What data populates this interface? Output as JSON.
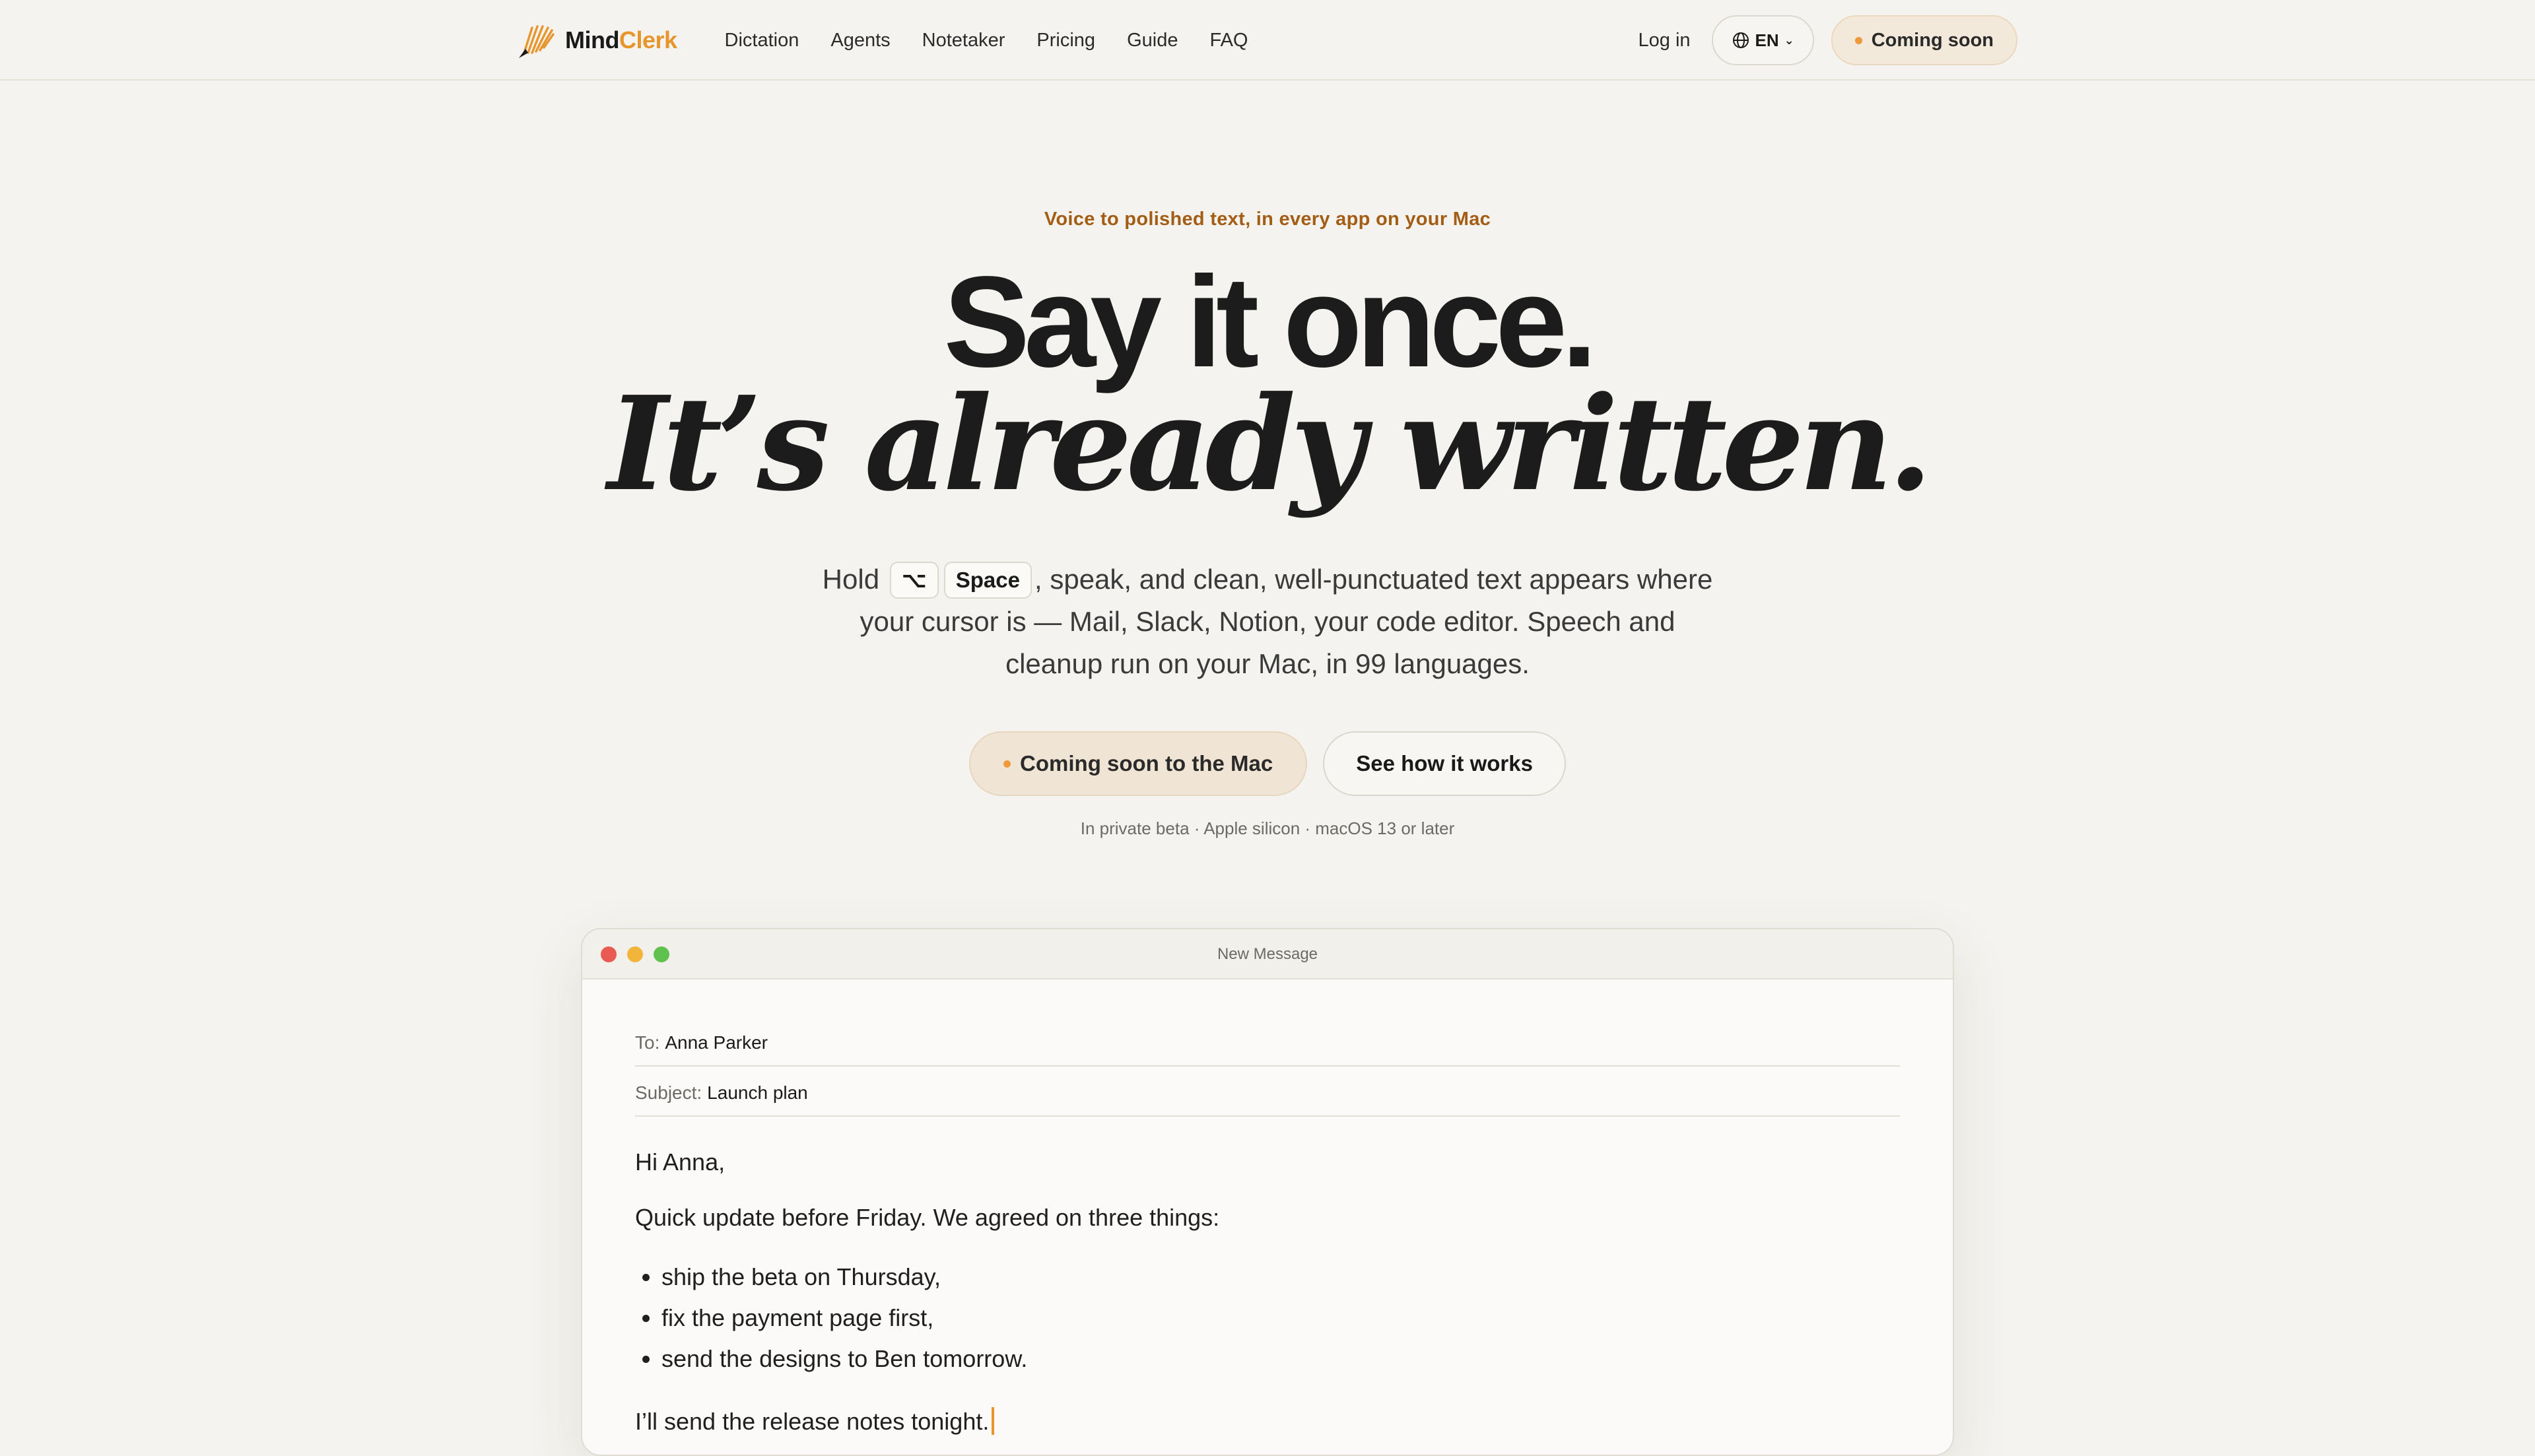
{
  "header": {
    "logo": {
      "mind": "Mind",
      "clerk": "Clerk"
    },
    "nav": [
      "Dictation",
      "Agents",
      "Notetaker",
      "Pricing",
      "Guide",
      "FAQ"
    ],
    "login": "Log in",
    "language": "EN",
    "coming_soon": "Coming soon"
  },
  "hero": {
    "eyebrow": "Voice to polished text, in every app on your Mac",
    "headline_line1": "Say it once.",
    "headline_line2": "It’s already written.",
    "lede_prefix": "Hold",
    "key_option": "⌥",
    "key_space": "Space",
    "lede_suffix": ", speak, and clean, well-punctuated text appears where your cursor is — Mail, Slack, Notion, your code editor. Speech and cleanup run on your Mac, in 99 languages.",
    "cta_primary": "Coming soon to the Mac",
    "cta_secondary": "See how it works",
    "fineprint": "In private beta · Apple silicon · macOS 13 or later"
  },
  "mail": {
    "window_title": "New Message",
    "to_label": "To:",
    "to_value": "Anna Parker",
    "subject_label": "Subject:",
    "subject_value": "Launch plan",
    "greeting": "Hi Anna,",
    "intro": "Quick update before Friday. We agreed on three things:",
    "items": [
      "ship the beta on Thursday,",
      "fix the payment page first,",
      "send the designs to Ben tomorrow."
    ],
    "closing": "I’ll send the release notes tonight."
  },
  "colors": {
    "accent": "#e8952c",
    "eyebrow": "#a35d15",
    "background": "#f4f3ef"
  }
}
